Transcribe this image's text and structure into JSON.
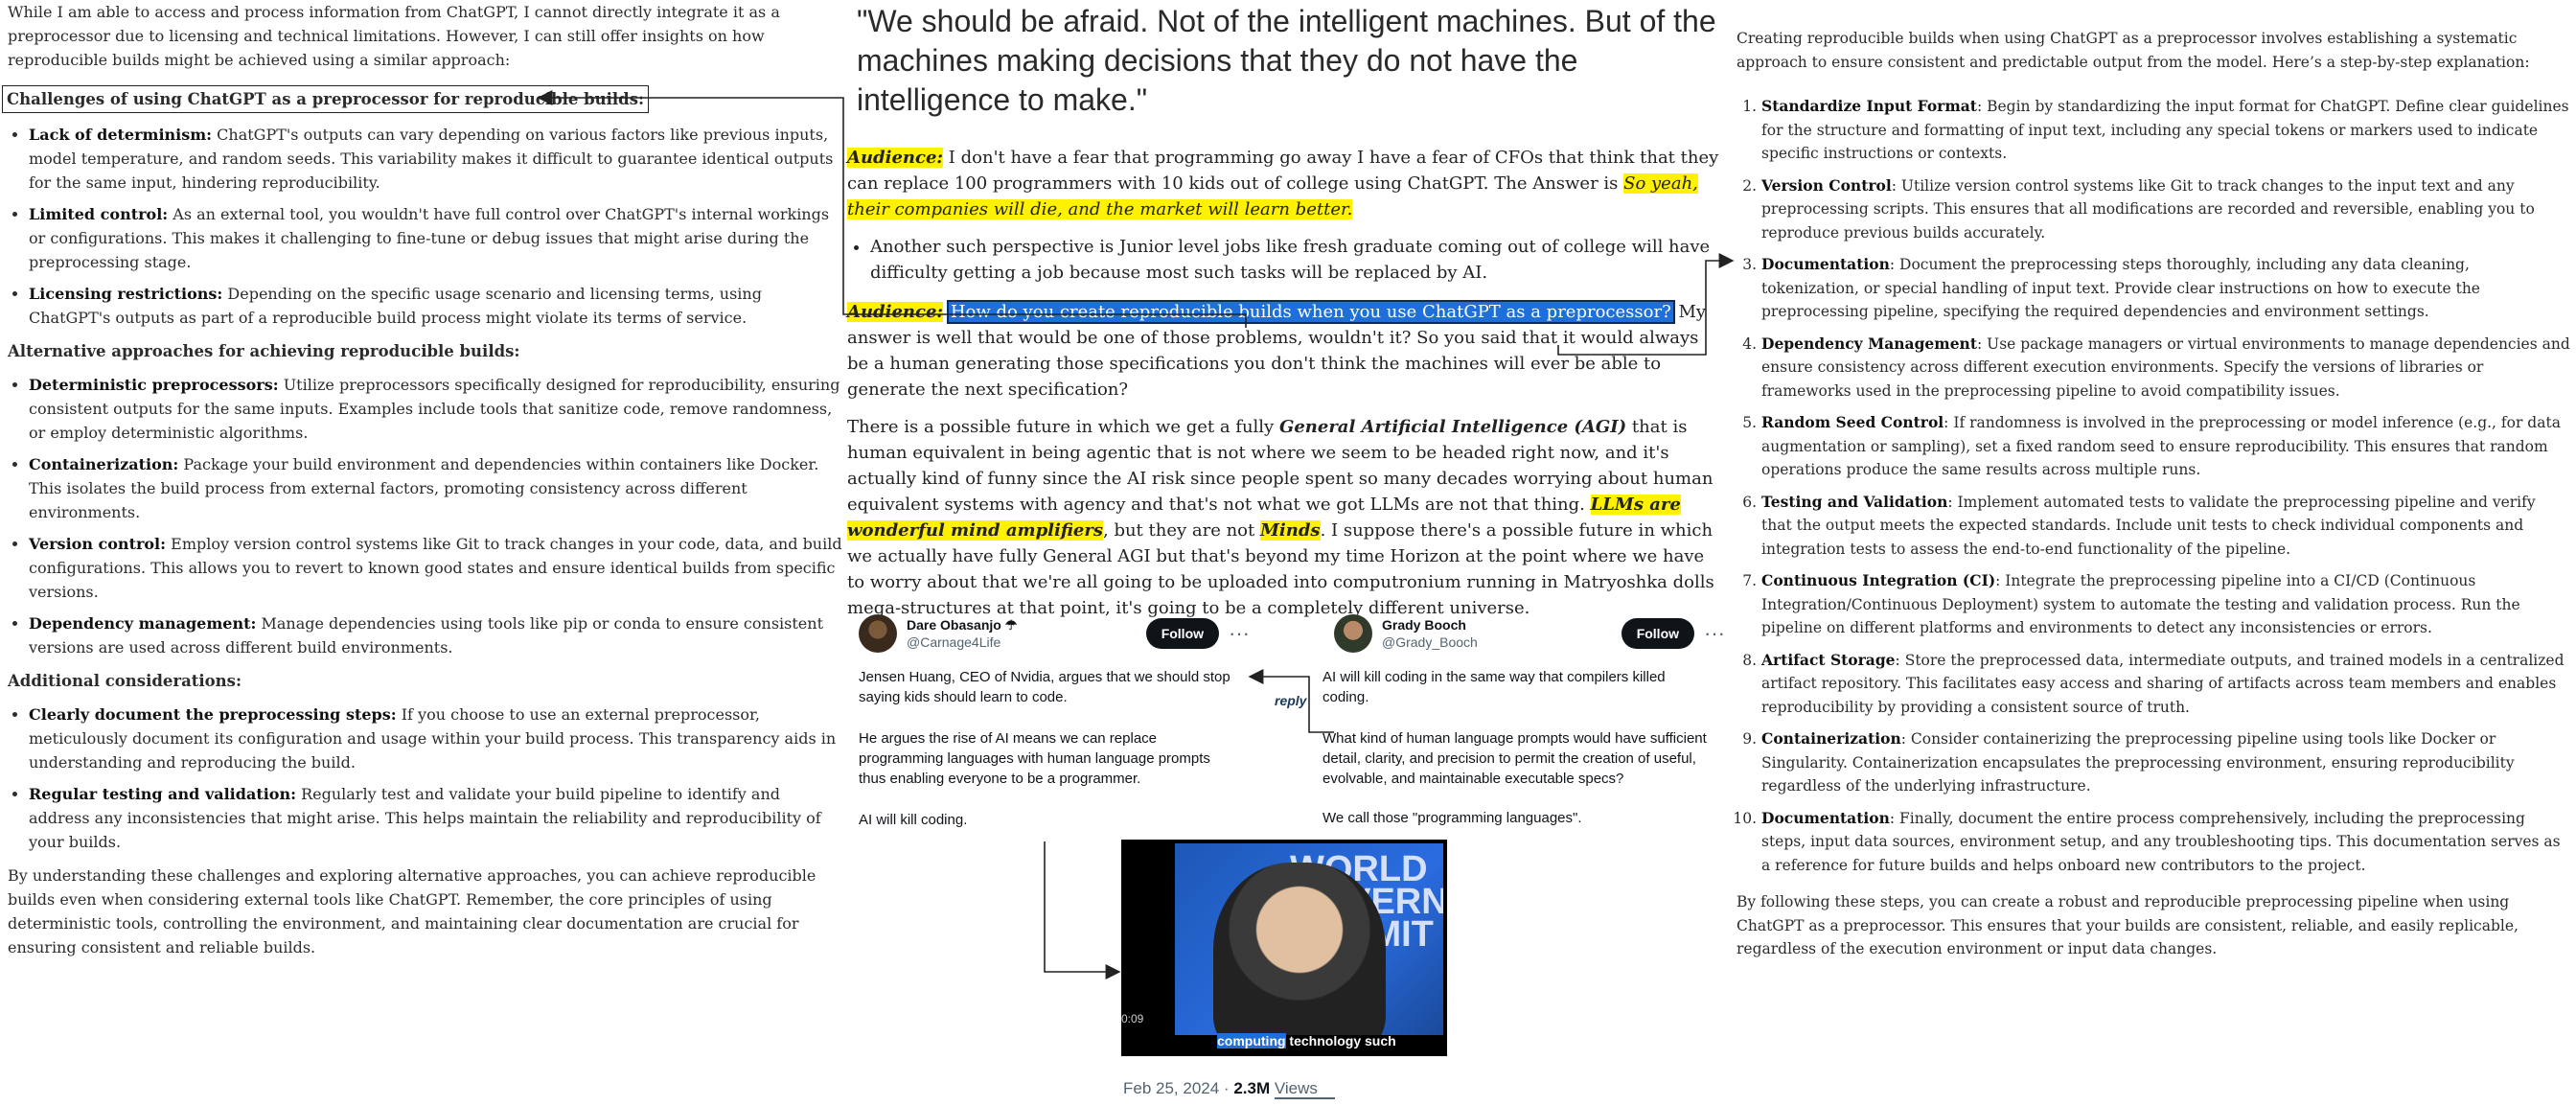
{
  "left": {
    "intro": "While I am able to access and process information from ChatGPT, I cannot directly integrate it as a preprocessor due to licensing and technical limitations. However, I can still offer insights on how reproducible builds might be achieved using a similar approach:",
    "challenges_heading": "Challenges of using ChatGPT as a preprocessor for reproducible builds:",
    "challenges": [
      {
        "term": "Lack of determinism:",
        "text": " ChatGPT's outputs can vary depending on various factors like previous inputs, model temperature, and random seeds. This variability makes it difficult to guarantee identical outputs for the same input, hindering reproducibility."
      },
      {
        "term": "Limited control:",
        "text": " As an external tool, you wouldn't have full control over ChatGPT's internal workings or configurations. This makes it challenging to fine-tune or debug issues that might arise during the preprocessing stage."
      },
      {
        "term": "Licensing restrictions:",
        "text": " Depending on the specific usage scenario and licensing terms, using ChatGPT's outputs as part of a reproducible build process might violate its terms of service."
      }
    ],
    "alt_heading": "Alternative approaches for achieving reproducible builds:",
    "alternatives": [
      {
        "term": "Deterministic preprocessors:",
        "text": " Utilize preprocessors specifically designed for reproducibility, ensuring consistent outputs for the same inputs. Examples include tools that sanitize code, remove randomness, or employ deterministic algorithms."
      },
      {
        "term": "Containerization:",
        "text": " Package your build environment and dependencies within containers like Docker. This isolates the build process from external factors, promoting consistency across different environments."
      },
      {
        "term": "Version control:",
        "text": " Employ version control systems like Git to track changes in your code, data, and build configurations. This allows you to revert to known good states and ensure identical builds from specific versions."
      },
      {
        "term": "Dependency management:",
        "text": " Manage dependencies using tools like pip or conda to ensure consistent versions are used across different build environments."
      }
    ],
    "add_heading": "Additional considerations:",
    "additional": [
      {
        "term": "Clearly document the preprocessing steps:",
        "text": " If you choose to use an external preprocessor, meticulously document its configuration and usage within your build process. This transparency aids in understanding and reproducing the build."
      },
      {
        "term": "Regular testing and validation:",
        "text": " Regularly test and validate your build pipeline to identify and address any inconsistencies that might arise. This helps maintain the reliability and reproducibility of your builds."
      }
    ],
    "conclusion": "By understanding these challenges and exploring alternative approaches, you can achieve reproducible builds even when considering external tools like ChatGPT. Remember, the core principles of using deterministic tools, controlling the environment, and maintaining clear documentation are crucial for ensuring consistent and reliable builds."
  },
  "middle": {
    "quote": "\"We should be afraid. Not of the intelligent machines. But of the machines making decisions that they do not have the intelligence to make.\"",
    "audience_label": "Audience:",
    "para1_text": " I don't have a fear that programming go away I have a fear of CFOs that think that they can replace 100 programmers with 10 kids out of college using ChatGPT. The Answer is ",
    "para1_highlight": "So yeah, their companies will die, and the market will learn better.",
    "bullet": "Another such perspective is Junior level jobs like fresh graduate coming out of college will have difficulty getting a job because most such tasks will be replaced by AI.",
    "audience2_label": "Audience:",
    "question": "How do you create reproducible builds when you use ChatGPT as a preprocessor?",
    "para2_rest": " My answer is well that would be one of those problems, wouldn't it? So you said that it would always be a human generating those specifications you don't think the machines will ever be able to generate the next specification?",
    "para3_a": "There is a possible future in which we get a fully ",
    "para3_agi": "General Artificial Intelligence (AGI)",
    "para3_b": " that is human equivalent in being agentic that is not where we seem to be headed right now, and it's actually kind of funny since the AI risk since people spent so many decades worrying about human equivalent systems with agency and that's not what we got LLMs are not that thing. ",
    "para3_hl1": "LLMs are wonderful mind amplifiers",
    "para3_c": ", but they are not ",
    "para3_hl2": "Minds",
    "para3_d": ". I suppose there's a possible future in which we actually have fully General AGI but that's beyond my time Horizon at the point where we have to worry about that we're all going to be uploaded into computronium running in Matryoshka dolls mega-structures at that point, it's going to be a completely different universe."
  },
  "tweets": {
    "left": {
      "name": "Dare Obasanjo",
      "name_suffix": "☂",
      "handle": "@Carnage4Life",
      "follow": "Follow",
      "more": "···",
      "p1": "Jensen Huang, CEO of Nvidia, argues that we should stop saying kids should learn to code.",
      "p2": "He argues the rise of AI means we can replace programming languages with human language prompts thus enabling everyone to be a programmer.",
      "p3": "AI will kill coding."
    },
    "right": {
      "name": "Grady Booch",
      "handle": "@Grady_Booch",
      "follow": "Follow",
      "more": "···",
      "p1": "AI will kill coding in the same way that compilers killed coding.",
      "p2": "What kind of human language prompts would have sufficient detail, clarity, and precision to permit the creation of useful, evolvable, and maintainable executable specs?",
      "p3": "We call those \"programming languages\"."
    },
    "reply_label": "reply",
    "video_caption_hl": "computing",
    "video_caption_rest": " technology such",
    "video_backdrop": "WORLD GOVERNMENT SUMMIT",
    "video_time": "0:09",
    "date": "Feb 25, 2024",
    "views_count": "2.3M",
    "views_label": "Views"
  },
  "right": {
    "intro": "Creating reproducible builds when using ChatGPT as a preprocessor involves establishing a systematic approach to ensure consistent and predictable output from the model. Here’s a step-by-step explanation:",
    "steps": [
      {
        "term": "Standardize Input Format",
        "text": ": Begin by standardizing the input format for ChatGPT. Define clear guidelines for the structure and formatting of input text, including any special tokens or markers used to indicate specific instructions or contexts."
      },
      {
        "term": "Version Control",
        "text": ": Utilize version control systems like Git to track changes to the input text and any preprocessing scripts. This ensures that all modifications are recorded and reversible, enabling you to reproduce previous builds accurately."
      },
      {
        "term": "Documentation",
        "text": ": Document the preprocessing steps thoroughly, including any data cleaning, tokenization, or special handling of input text. Provide clear instructions on how to execute the preprocessing pipeline, specifying the required dependencies and environment settings."
      },
      {
        "term": "Dependency Management",
        "text": ": Use package managers or virtual environments to manage dependencies and ensure consistency across different execution environments. Specify the versions of libraries or frameworks used in the preprocessing pipeline to avoid compatibility issues."
      },
      {
        "term": "Random Seed Control",
        "text": ": If randomness is involved in the preprocessing or model inference (e.g., for data augmentation or sampling), set a fixed random seed to ensure reproducibility. This ensures that random operations produce the same results across multiple runs."
      },
      {
        "term": "Testing and Validation",
        "text": ": Implement automated tests to validate the preprocessing pipeline and verify that the output meets the expected standards. Include unit tests to check individual components and integration tests to assess the end-to-end functionality of the pipeline."
      },
      {
        "term": "Continuous Integration (CI)",
        "text": ": Integrate the preprocessing pipeline into a CI/CD (Continuous Integration/Continuous Deployment) system to automate the testing and validation process. Run the pipeline on different platforms and environments to detect any inconsistencies or errors."
      },
      {
        "term": "Artifact Storage",
        "text": ": Store the preprocessed data, intermediate outputs, and trained models in a centralized artifact repository. This facilitates easy access and sharing of artifacts across team members and enables reproducibility by providing a consistent source of truth."
      },
      {
        "term": "Containerization",
        "text": ": Consider containerizing the preprocessing pipeline using tools like Docker or Singularity. Containerization encapsulates the preprocessing environment, ensuring reproducibility regardless of the underlying infrastructure."
      },
      {
        "term": "Documentation",
        "text": ": Finally, document the entire process comprehensively, including the preprocessing steps, input data sources, environment setup, and any troubleshooting tips. This documentation serves as a reference for future builds and helps onboard new contributors to the project."
      }
    ],
    "conclusion": "By following these steps, you can create a robust and reproducible preprocessing pipeline when using ChatGPT as a preprocessor. This ensures that your builds are consistent, reliable, and easily replicable, regardless of the execution environment or input data changes."
  }
}
